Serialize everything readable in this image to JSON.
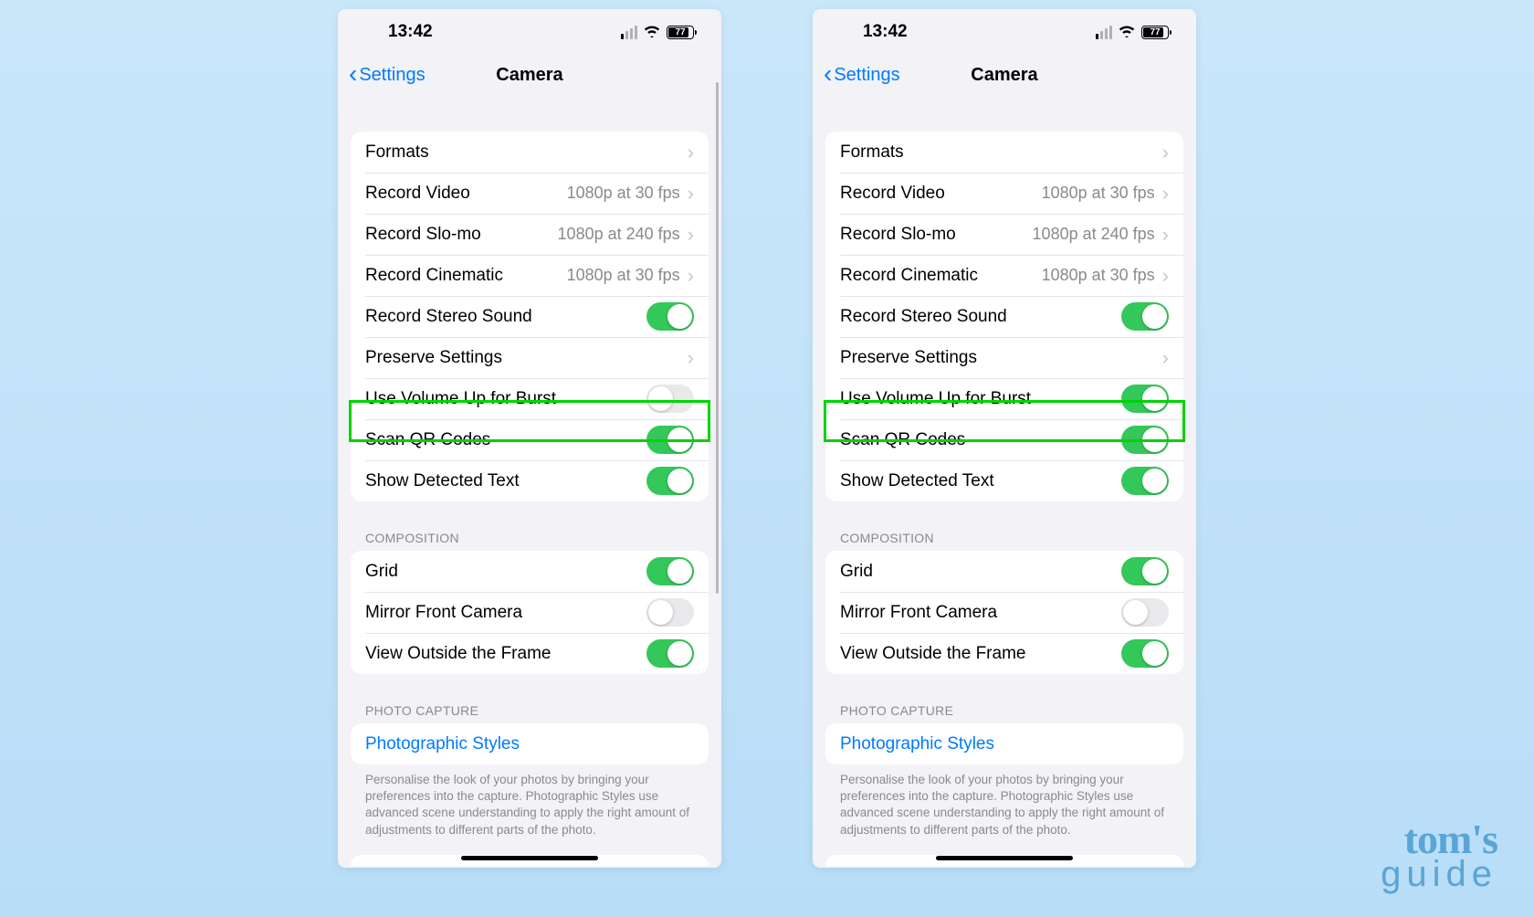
{
  "status": {
    "time": "13:42",
    "battery_pct": "77"
  },
  "nav": {
    "back_label": "Settings",
    "title": "Camera"
  },
  "group1": {
    "formats": "Formats",
    "record_video": "Record Video",
    "record_video_val": "1080p at 30 fps",
    "record_slomo": "Record Slo-mo",
    "record_slomo_val": "1080p at 240 fps",
    "record_cinematic": "Record Cinematic",
    "record_cinematic_val": "1080p at 30 fps",
    "stereo": "Record Stereo Sound",
    "preserve": "Preserve Settings",
    "volume_burst": "Use Volume Up for Burst",
    "scan_qr": "Scan QR Codes",
    "detected_text": "Show Detected Text"
  },
  "composition": {
    "header": "COMPOSITION",
    "grid": "Grid",
    "mirror": "Mirror Front Camera",
    "outside": "View Outside the Frame"
  },
  "photo_capture": {
    "header": "PHOTO CAPTURE",
    "styles": "Photographic Styles",
    "footer": "Personalise the look of your photos by bringing your preferences into the capture. Photographic Styles use advanced scene understanding to apply the right amount of adjustments to different parts of the photo."
  },
  "toggles_left": {
    "stereo": true,
    "volume_burst": false,
    "scan_qr": true,
    "detected_text": true,
    "grid": true,
    "mirror": false,
    "outside": true
  },
  "toggles_right": {
    "stereo": true,
    "volume_burst": true,
    "scan_qr": true,
    "detected_text": true,
    "grid": true,
    "mirror": false,
    "outside": true
  },
  "watermark": {
    "line1": "tom's",
    "line2": "guide"
  }
}
